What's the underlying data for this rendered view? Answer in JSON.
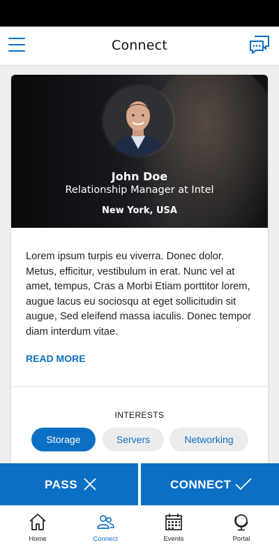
{
  "header": {
    "title": "Connect"
  },
  "profile": {
    "name": "John Doe",
    "role": "Relationship Manager at Intel",
    "location": "New York, USA",
    "bio": "Lorem ipsum turpis eu viverra. Donec dolor. Metus, efficitur, vestibulum in erat. Nunc vel at amet, tempus, Cras a Morbi Etiam porttitor lorem, augue lacus eu sociosqu at eget sollicitudin sit augue, Sed eleifend massa iaculis. Donec tempor diam interdum vitae.",
    "read_more": "READ MORE"
  },
  "interests": {
    "title": "INTERESTS",
    "items": [
      {
        "label": "Storage",
        "selected": true
      },
      {
        "label": "Servers",
        "selected": false
      },
      {
        "label": "Networking",
        "selected": false
      }
    ]
  },
  "actions": {
    "pass_label": "PASS",
    "connect_label": "CONNECT"
  },
  "tabs": [
    {
      "label": "Home",
      "icon": "home-icon",
      "active": false
    },
    {
      "label": "Connect",
      "icon": "people-icon",
      "active": true
    },
    {
      "label": "Events",
      "icon": "calendar-icon",
      "active": false
    },
    {
      "label": "Portal",
      "icon": "globe-icon",
      "active": false
    }
  ],
  "colors": {
    "accent": "#0b6fc4",
    "chip_bg": "#ececec",
    "status_bar": "#000000"
  }
}
